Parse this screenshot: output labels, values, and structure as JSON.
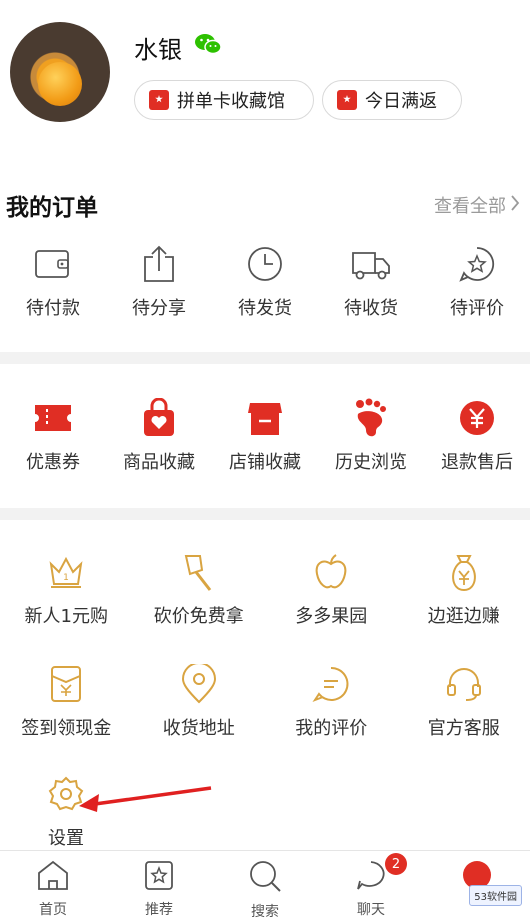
{
  "profile": {
    "username": "水银",
    "chips": [
      {
        "label": "拼单卡收藏馆"
      },
      {
        "label": "今日满返"
      }
    ]
  },
  "orders": {
    "title": "我的订单",
    "view_all": "查看全部",
    "items": [
      {
        "label": "待付款",
        "icon": "wallet-icon"
      },
      {
        "label": "待分享",
        "icon": "share-icon"
      },
      {
        "label": "待发货",
        "icon": "clock-icon"
      },
      {
        "label": "待收货",
        "icon": "truck-icon"
      },
      {
        "label": "待评价",
        "icon": "star-bubble-icon"
      }
    ]
  },
  "shortcuts": [
    {
      "label": "优惠券",
      "icon": "coupon-icon"
    },
    {
      "label": "商品收藏",
      "icon": "bag-heart-icon"
    },
    {
      "label": "店铺收藏",
      "icon": "shop-icon"
    },
    {
      "label": "历史浏览",
      "icon": "footprint-icon"
    },
    {
      "label": "退款售后",
      "icon": "yen-circle-icon"
    }
  ],
  "services_row1": [
    {
      "label": "新人1元购",
      "icon": "crown-icon"
    },
    {
      "label": "砍价免费拿",
      "icon": "axe-icon"
    },
    {
      "label": "多多果园",
      "icon": "apple-icon"
    },
    {
      "label": "边逛边赚",
      "icon": "money-bag-icon"
    }
  ],
  "services_row2": [
    {
      "label": "签到领现金",
      "icon": "envelope-yen-icon"
    },
    {
      "label": "收货地址",
      "icon": "location-pin-icon"
    },
    {
      "label": "我的评价",
      "icon": "comment-icon"
    },
    {
      "label": "官方客服",
      "icon": "headset-icon"
    }
  ],
  "settings": {
    "label": "设置",
    "icon": "gear-icon"
  },
  "bottom_nav": [
    {
      "label": "首页",
      "icon": "home-icon"
    },
    {
      "label": "推荐",
      "icon": "star-bag-icon"
    },
    {
      "label": "搜索",
      "icon": "search-icon"
    },
    {
      "label": "聊天",
      "icon": "chat-icon",
      "badge": "2"
    },
    {
      "label": "",
      "icon": "profile-icon"
    }
  ],
  "watermark": "53软件园",
  "colors": {
    "accent": "#e02e24",
    "secondary": "#d9a441"
  }
}
